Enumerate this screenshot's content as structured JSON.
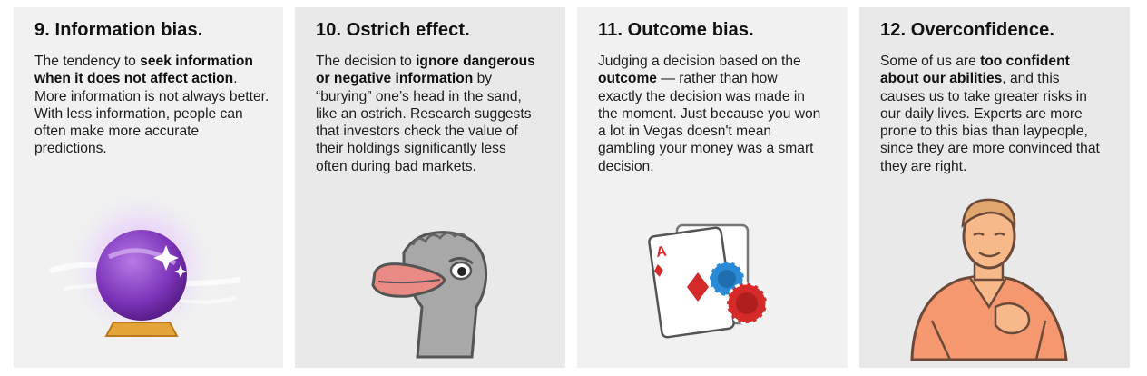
{
  "cards": [
    {
      "title": "9. Information bias.",
      "text": [
        {
          "t": "The tendency to "
        },
        {
          "t": "seek information when it does not affect action",
          "b": true
        },
        {
          "t": ". More information is not always better. With less information, people can often make more accurate predictions."
        }
      ],
      "icon": "crystal-ball-icon"
    },
    {
      "title": "10. Ostrich effect.",
      "text": [
        {
          "t": "The decision to "
        },
        {
          "t": "ignore dangerous or negative information",
          "b": true
        },
        {
          "t": " by “burying” one’s head in the sand, like an ostrich. Research suggests that investors check the value of their holdings significantly less often during bad markets."
        }
      ],
      "icon": "ostrich-icon"
    },
    {
      "title": "11. Outcome bias.",
      "text": [
        {
          "t": "Judging a decision based on the "
        },
        {
          "t": "outcome",
          "b": true
        },
        {
          "t": " — rather than how exactly the decision was made in the moment. Just because you won a lot in Vegas doesn't mean gambling your money was a smart decision."
        }
      ],
      "icon": "playing-card-chips-icon",
      "card_rank": "A"
    },
    {
      "title": "12. Overconfidence.",
      "text": [
        {
          "t": "Some of us are "
        },
        {
          "t": "too confident about our abilities",
          "b": true
        },
        {
          "t": ", and this causes us to take greater risks in our daily lives. Experts are more prone to this bias than laypeople, since they are more convinced that they are right."
        }
      ],
      "icon": "confident-man-icon"
    }
  ],
  "colors": {
    "card_bg": "#f1f1f1",
    "card_bg_alt": "#e9e9e9",
    "crystal_purple": "#8a3fc4",
    "chip_blue": "#2a8ad6",
    "chip_red": "#d42a2a",
    "skin": "#f7b98a"
  }
}
